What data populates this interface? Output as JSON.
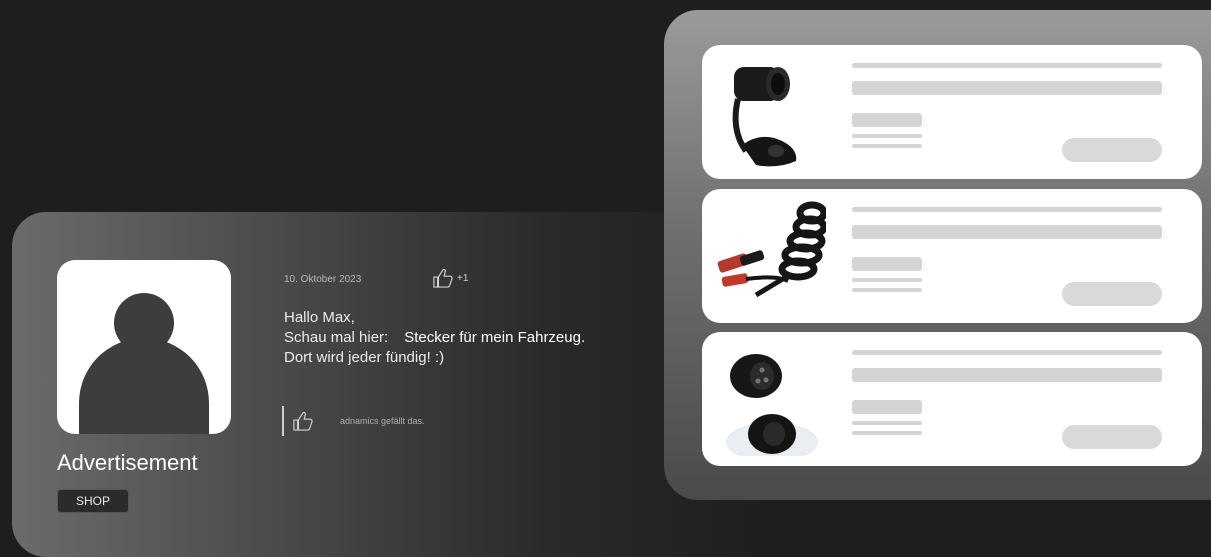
{
  "comment": {
    "date": "10. Oktober 2023",
    "like_count": "+1",
    "greeting": "Hallo Max,",
    "line2_prefix": "Schau mal hier:",
    "line2_link": "Stecker für mein Fahrzeug.",
    "line3": "Dort wird jeder fündig! :)",
    "liked_by": "adnamics gefällt das."
  },
  "advertiser": {
    "name": "Advertisement",
    "badge": "SHOP"
  },
  "products": [
    {
      "icon": "socket-plug-icon"
    },
    {
      "icon": "coiled-cable-icon"
    },
    {
      "icon": "adapter-plug-icon"
    }
  ]
}
